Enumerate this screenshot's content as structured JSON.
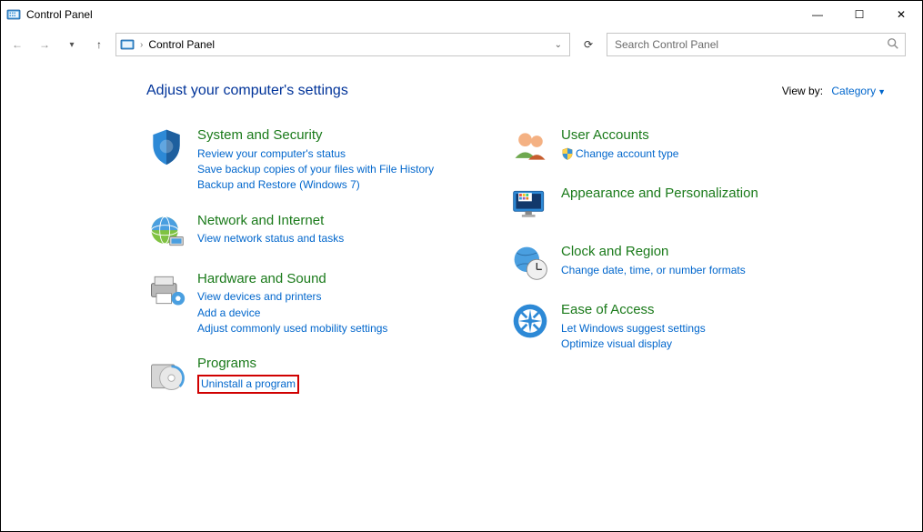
{
  "window": {
    "title": "Control Panel",
    "minimize_symbol": "—",
    "maximize_symbol": "☐",
    "close_symbol": "✕"
  },
  "nav": {
    "back_symbol": "←",
    "forward_symbol": "→",
    "up_symbol": "↑",
    "breadcrumb": "Control Panel",
    "refresh_symbol": "⟳",
    "search_placeholder": "Search Control Panel"
  },
  "header": {
    "title": "Adjust your computer's settings",
    "viewby_label": "View by:",
    "viewby_value": "Category"
  },
  "categories": {
    "system_security": {
      "title": "System and Security",
      "links": [
        "Review your computer's status",
        "Save backup copies of your files with File History",
        "Backup and Restore (Windows 7)"
      ]
    },
    "network": {
      "title": "Network and Internet",
      "links": [
        "View network status and tasks"
      ]
    },
    "hardware": {
      "title": "Hardware and Sound",
      "links": [
        "View devices and printers",
        "Add a device",
        "Adjust commonly used mobility settings"
      ]
    },
    "programs": {
      "title": "Programs",
      "links": [
        "Uninstall a program"
      ]
    },
    "users": {
      "title": "User Accounts",
      "links": [
        "Change account type"
      ]
    },
    "appearance": {
      "title": "Appearance and Personalization"
    },
    "clock": {
      "title": "Clock and Region",
      "links": [
        "Change date, time, or number formats"
      ]
    },
    "ease": {
      "title": "Ease of Access",
      "links": [
        "Let Windows suggest settings",
        "Optimize visual display"
      ]
    }
  }
}
